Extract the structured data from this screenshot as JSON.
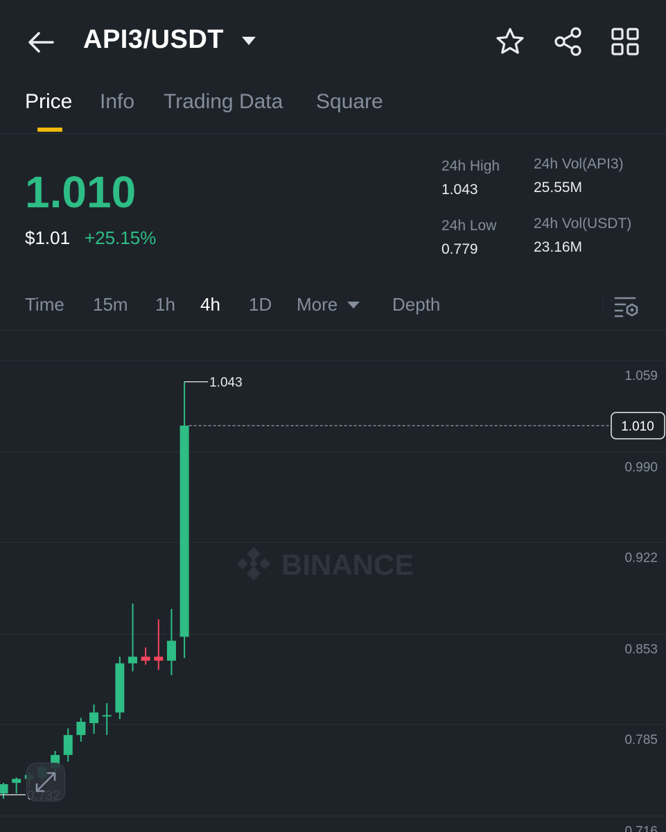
{
  "header": {
    "pair": "API3/USDT",
    "icons": [
      "back-arrow-icon",
      "caret-down-icon",
      "star-icon",
      "share-icon",
      "grid-icon"
    ]
  },
  "tabs": [
    {
      "label": "Price",
      "active": true
    },
    {
      "label": "Info",
      "active": false
    },
    {
      "label": "Trading Data",
      "active": false
    },
    {
      "label": "Square",
      "active": false
    }
  ],
  "ticker": {
    "last_price": "1.010",
    "usd_price": "$1.01",
    "change": "+25.15%",
    "high_label": "24h High",
    "high_value": "1.043",
    "low_label": "24h Low",
    "low_value": "0.779",
    "vol_base_label": "24h Vol(API3)",
    "vol_base_value": "25.55M",
    "vol_quote_label": "24h Vol(USDT)",
    "vol_quote_value": "23.16M"
  },
  "intervals": {
    "time": "Time",
    "m15": "15m",
    "h1": "1h",
    "h4": "4h",
    "d1": "1D",
    "more": "More",
    "depth": "Depth",
    "active": "4h"
  },
  "colors": {
    "up": "#2ebd85",
    "down": "#f6465d",
    "accent": "#f0b90b",
    "background": "#1e2329",
    "muted": "#848e9c"
  },
  "chart_data": {
    "type": "candlestick",
    "watermark": "BINANCE",
    "y_ticks": [
      "1.059",
      "0.990",
      "0.922",
      "0.853",
      "0.785",
      "0.716"
    ],
    "y_tick_values": [
      1.059,
      0.99,
      0.922,
      0.853,
      0.785,
      0.716
    ],
    "ylim": [
      0.716,
      1.059
    ],
    "current_price": 1.01,
    "current_price_label": "1.010",
    "high_marker": 1.043,
    "high_marker_label": "1.043",
    "low_marker": 0.732,
    "low_marker_label": "0.732",
    "candles": [
      {
        "o": 0.733,
        "h": 0.741,
        "l": 0.729,
        "c": 0.74
      },
      {
        "o": 0.741,
        "h": 0.745,
        "l": 0.733,
        "c": 0.744
      },
      {
        "o": 0.744,
        "h": 0.749,
        "l": 0.738,
        "c": 0.747
      },
      {
        "o": 0.745,
        "h": 0.756,
        "l": 0.741,
        "c": 0.753
      },
      {
        "o": 0.752,
        "h": 0.765,
        "l": 0.749,
        "c": 0.762
      },
      {
        "o": 0.762,
        "h": 0.782,
        "l": 0.757,
        "c": 0.777
      },
      {
        "o": 0.777,
        "h": 0.79,
        "l": 0.772,
        "c": 0.787
      },
      {
        "o": 0.786,
        "h": 0.8,
        "l": 0.778,
        "c": 0.794
      },
      {
        "o": 0.791,
        "h": 0.801,
        "l": 0.777,
        "c": 0.792
      },
      {
        "o": 0.794,
        "h": 0.836,
        "l": 0.789,
        "c": 0.831
      },
      {
        "o": 0.831,
        "h": 0.876,
        "l": 0.825,
        "c": 0.836
      },
      {
        "o": 0.836,
        "h": 0.843,
        "l": 0.83,
        "c": 0.833
      },
      {
        "o": 0.836,
        "h": 0.864,
        "l": 0.826,
        "c": 0.833
      },
      {
        "o": 0.833,
        "h": 0.872,
        "l": 0.822,
        "c": 0.848
      },
      {
        "o": 0.851,
        "h": 1.043,
        "l": 0.835,
        "c": 1.01
      }
    ]
  }
}
